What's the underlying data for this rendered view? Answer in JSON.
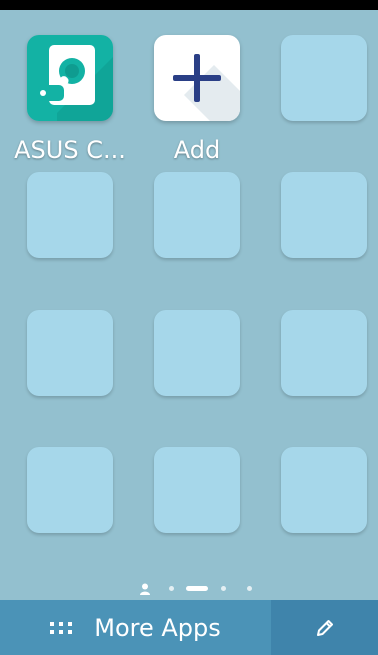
{
  "home_screen": {
    "apps": [
      {
        "label": "ASUS C...",
        "icon": "asus-app-icon",
        "color": "#13b2a4"
      },
      {
        "label": "Add",
        "icon": "plus-icon",
        "color": "#2a3f86"
      }
    ],
    "empty_slots": 10,
    "page_indicator": {
      "pages": 4,
      "current": 1,
      "has_home_page": true
    }
  },
  "bottom_bar": {
    "more_apps_label": "More Apps",
    "more_apps_icon": "app-grid-icon",
    "edit_icon": "pencil-icon"
  },
  "colors": {
    "background": "#93c0cf",
    "tile": "#a6d7ea",
    "more_apps_bg": "#4b93b7",
    "edit_bg": "#3f84ab"
  }
}
